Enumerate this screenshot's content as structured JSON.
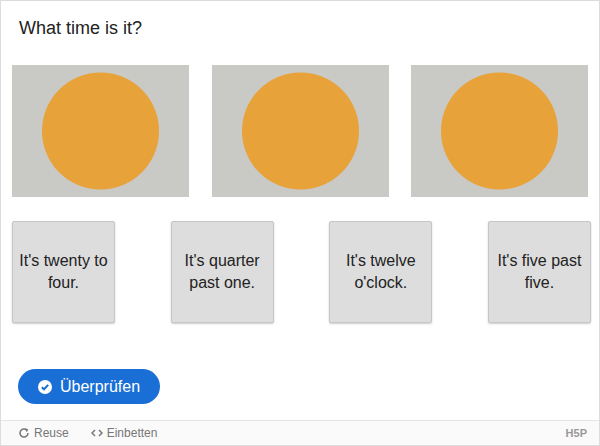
{
  "title": "What time is it?",
  "images": [
    {
      "kind": "photo"
    },
    {
      "kind": "photo"
    },
    {
      "kind": "photo"
    }
  ],
  "answers": [
    "It's twenty to four.",
    "It's quarter past one.",
    "It's twelve o'clock.",
    "It's five past five."
  ],
  "check_button": {
    "label": "Überprüfen"
  },
  "footer": {
    "actions": [
      {
        "label": "Reuse",
        "kind": "reuse"
      },
      {
        "label": "Einbetten",
        "kind": "embed"
      }
    ],
    "logo": "H5P"
  }
}
